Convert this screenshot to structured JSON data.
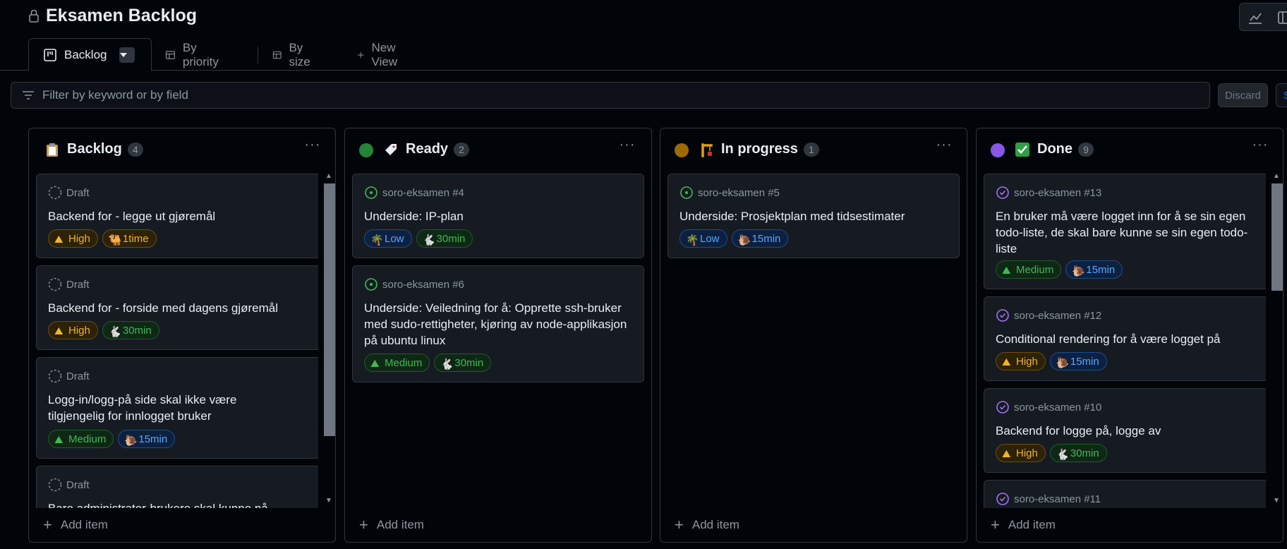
{
  "header": {
    "title": "Eksamen Backlog"
  },
  "tabs": [
    {
      "label": "Backlog",
      "icon": "board-icon"
    },
    {
      "label": "By priority",
      "icon": "table-icon"
    },
    {
      "label": "By size",
      "icon": "table-icon"
    },
    {
      "label": "New View",
      "icon": "plus-icon"
    }
  ],
  "filter": {
    "placeholder": "Filter by keyword or by field"
  },
  "buttons": {
    "discard": "Discard",
    "save": "S"
  },
  "columns": [
    {
      "title": "Backlog",
      "count": "4",
      "emoji": "clipboard-icon",
      "cards": [
        {
          "meta": "Draft",
          "title": "Backend for - legge ut gjøremål",
          "labels": [
            "High",
            "1time"
          ]
        },
        {
          "meta": "Draft",
          "title": "Backend for - forside med dagens gjøremål",
          "labels": [
            "High",
            "30min"
          ]
        },
        {
          "meta": "Draft",
          "title": "Logg-in/logg-på side skal ikke være tilgjengelig for innlogget bruker",
          "labels": [
            "Medium",
            "15min"
          ]
        },
        {
          "meta": "Draft",
          "title": "Bare administrator-brukere skal kunne på",
          "labels": []
        }
      ],
      "add": "Add item"
    },
    {
      "title": "Ready",
      "count": "2",
      "dot": "#238636",
      "emoji": "label-icon",
      "cards": [
        {
          "meta": "soro-eksamen #4",
          "title": "Underside: IP-plan",
          "labels": [
            "Low",
            "30min"
          ]
        },
        {
          "meta": "soro-eksamen #6",
          "title": "Underside: Veiledning for å: Opprette ssh-bruker med sudo-rettigheter, kjøring av node-applikasjon på ubuntu linux",
          "labels": [
            "Medium",
            "30min"
          ]
        }
      ],
      "add": "Add item"
    },
    {
      "title": "In progress",
      "count": "1",
      "dot": "#9e6a03",
      "emoji": "crane-icon",
      "cards": [
        {
          "meta": "soro-eksamen #5",
          "title": "Underside: Prosjektplan med tidsestimater",
          "labels": [
            "Low",
            "15min"
          ]
        }
      ],
      "add": "Add item"
    },
    {
      "title": "Done",
      "count": "9",
      "dot": "#8957e5",
      "emoji": "check-box-icon",
      "cards": [
        {
          "meta": "soro-eksamen #13",
          "title": "En bruker må være logget inn for å se sin egen todo-liste, de skal bare kunne se sin egen todo-liste",
          "labels": [
            "Medium",
            "15min"
          ]
        },
        {
          "meta": "soro-eksamen #12",
          "title": "Conditional rendering for å være logget på",
          "labels": [
            "High",
            "15min"
          ]
        },
        {
          "meta": "soro-eksamen #10",
          "title": "Backend for logge på, logge av",
          "labels": [
            "High",
            "30min"
          ]
        },
        {
          "meta": "soro-eksamen #11",
          "title": "",
          "labels": []
        }
      ],
      "add": "Add item"
    }
  ]
}
